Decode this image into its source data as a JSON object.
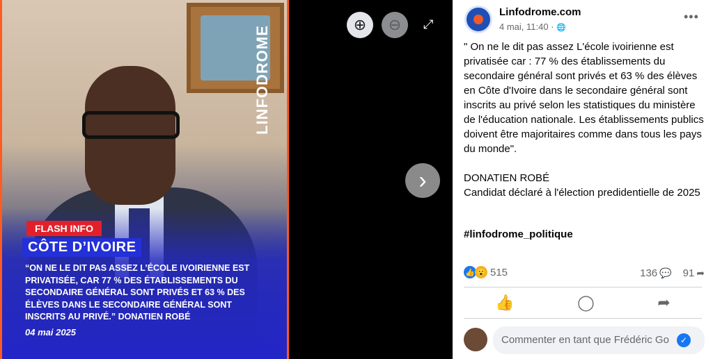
{
  "photo": {
    "logo_text": "LINFODROME",
    "flash_label": "FLASH INFO",
    "country": "CÔTE D’IVOIRE",
    "quote": "“ON NE LE DIT PAS ASSEZ L’ÉCOLE IVOIRIENNE EST PRIVATISÉE, CAR 77 % DES ÉTABLISSEMENTS DU SECONDAIRE GÉNÉRAL SONT PRIVÉS ET 63 % DES ÉLÈVES  DANS LE SECONDAIRE GÉNÉRAL SONT INSCRITS AU PRIVÉ.” DONATIEN ROBÉ",
    "date": "04 mai 2025"
  },
  "viewer": {
    "zoom_in_icon": "zoom-in-icon",
    "zoom_out_icon": "zoom-out-icon",
    "expand_icon": "expand-icon",
    "next_icon": "chevron-right-icon",
    "next_glyph": "›",
    "zoom_in_glyph": "⊕",
    "zoom_out_glyph": "⊖",
    "expand_glyph": "⤢"
  },
  "post": {
    "page_name": "Linfodrome.com",
    "timestamp": "4 mai, 11:40 ·",
    "privacy_glyph": "🌐",
    "more_glyph": "•••",
    "text": "\" On ne le dit pas assez L'école ivoirienne est privatisée car : 77 % des établissements du secondaire général sont privés et 63 % des élèves en Côte d'Ivoire dans le secondaire général sont inscrits au privé selon les statistiques du ministère de l'éducation nationale. Les établissements publics doivent être majoritaires comme dans tous les pays du monde\".\n\nDONATIEN ROBÉ\nCandidat déclaré à l'élection predidentielle de 2025",
    "hashtag": "#linfodrome_politique",
    "reaction_count": "515",
    "comment_count": "136",
    "share_count": "91",
    "like_glyph": "👍",
    "wow_glyph": "😮",
    "comment_glyph": "💬",
    "share_glyph": "➦",
    "action_like_glyph": "👍",
    "action_comment_glyph": "◯",
    "action_share_glyph": "➦",
    "comment_placeholder": "Commenter en tant que Frédéric Go",
    "verified_glyph": "✓"
  }
}
